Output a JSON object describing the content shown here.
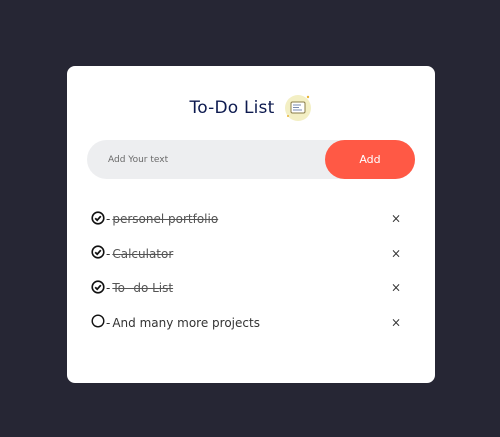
{
  "app": {
    "title": "To-Do List"
  },
  "input": {
    "placeholder": "Add Your text",
    "value": ""
  },
  "add_button": {
    "label": "Add"
  },
  "items": [
    {
      "label": "personel portfolio",
      "done": true,
      "delete_label": "×"
    },
    {
      "label": "Calculator",
      "done": true,
      "delete_label": "×"
    },
    {
      "label": "To- do List",
      "done": true,
      "delete_label": "×"
    },
    {
      "label": "And many more projects",
      "done": false,
      "delete_label": "×"
    }
  ],
  "separator": "-",
  "colors": {
    "background": "#262634",
    "card": "#ffffff",
    "accent": "#ff5945",
    "title": "#0d1a4f",
    "input_bg": "#edeef0"
  }
}
